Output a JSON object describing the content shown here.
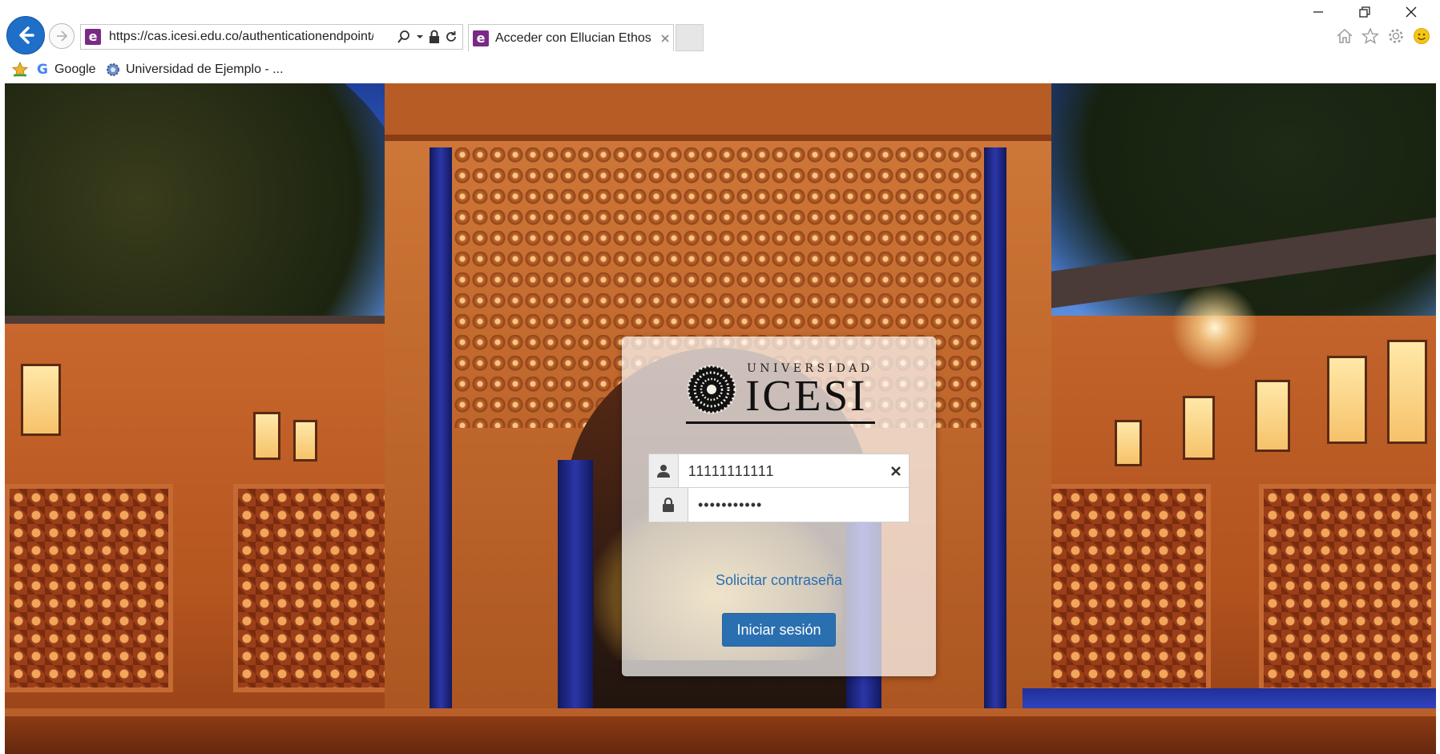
{
  "browser": {
    "url": "https://cas.icesi.edu.co/authenticationendpoint/lo",
    "tab_title": "Acceder con Ellucian Ethos ...",
    "favorites": [
      {
        "label": "Google",
        "icon": "google-icon"
      },
      {
        "label": "Universidad de Ejemplo - ...",
        "icon": "gear-icon"
      }
    ],
    "window_controls": [
      "minimize-icon",
      "restore-icon",
      "close-icon"
    ],
    "toolbar_icons": [
      "home-icon",
      "star-icon",
      "gear-icon",
      "smiley-icon"
    ]
  },
  "login": {
    "logo_top": "UNIVERSIDAD",
    "logo_main": "ICESI",
    "username_value": "11111111111",
    "password_value": "•••••••••••",
    "forgot_link": "Solicitar contraseña",
    "submit_label": "Iniciar sesión"
  },
  "colors": {
    "accent": "#2a6fb0",
    "back_button": "#1f6fc9",
    "ie_icon": "#7a2a86"
  }
}
